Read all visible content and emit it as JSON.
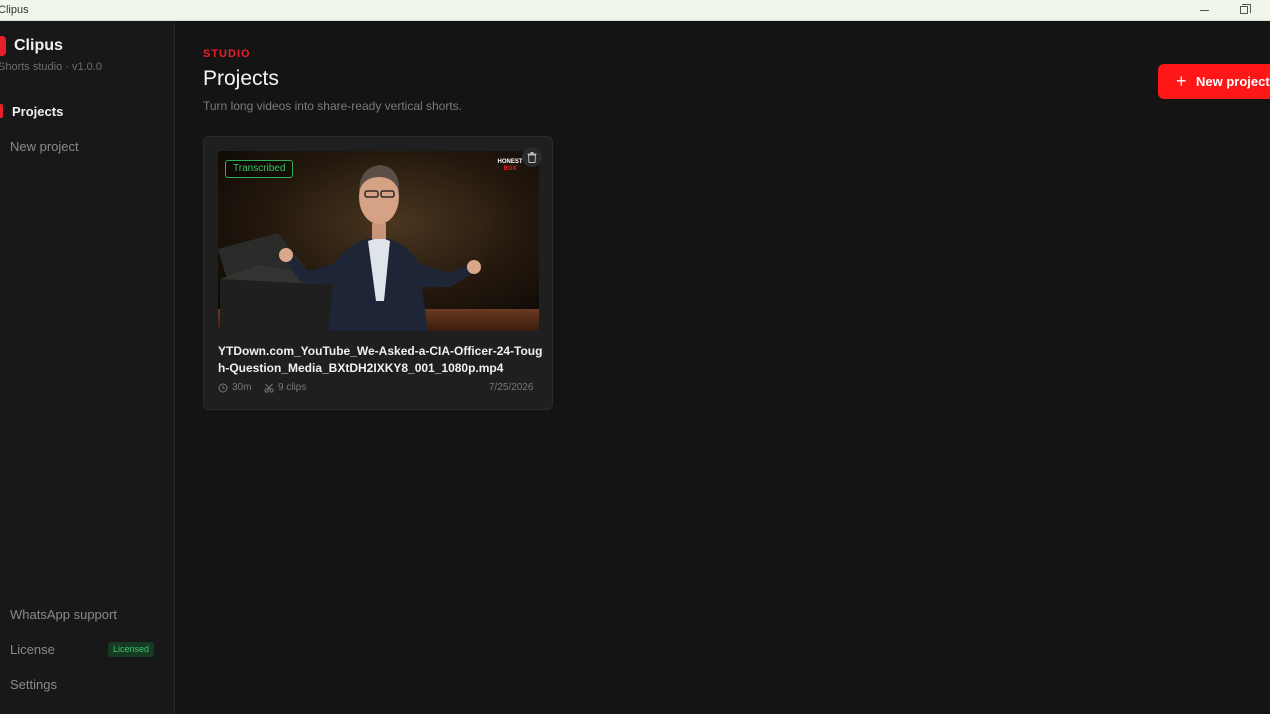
{
  "window": {
    "title": "Clipus"
  },
  "brand": {
    "name": "Clipus",
    "subtitle": "Shorts studio · v1.0.0"
  },
  "sidebar": {
    "nav": [
      {
        "label": "Projects",
        "active": true
      },
      {
        "label": "New project",
        "active": false
      }
    ],
    "footer": [
      {
        "label": "WhatsApp support"
      },
      {
        "label": "License",
        "badge": "Licensed"
      },
      {
        "label": "Settings"
      }
    ]
  },
  "header": {
    "eyebrow": "STUDIO",
    "title": "Projects",
    "subtitle": "Turn long videos into share-ready vertical shorts.",
    "new_button": {
      "icon": "plus-icon",
      "label": "New project"
    }
  },
  "projects": [
    {
      "status": "Transcribed",
      "title": "YTDown.com_YouTube_We-Asked-a-CIA-Officer-24-Tough-Question_Media_BXtDH2IXKY8_001_1080p.mp4",
      "duration": "30m",
      "clips": "9 clips",
      "date": "7/25/2026",
      "thumbnail_logo": "HONEST BOX"
    }
  ],
  "colors": {
    "accent": "#ff1717",
    "background": "#141414",
    "sidebar": "#181818",
    "success": "#36c163"
  }
}
